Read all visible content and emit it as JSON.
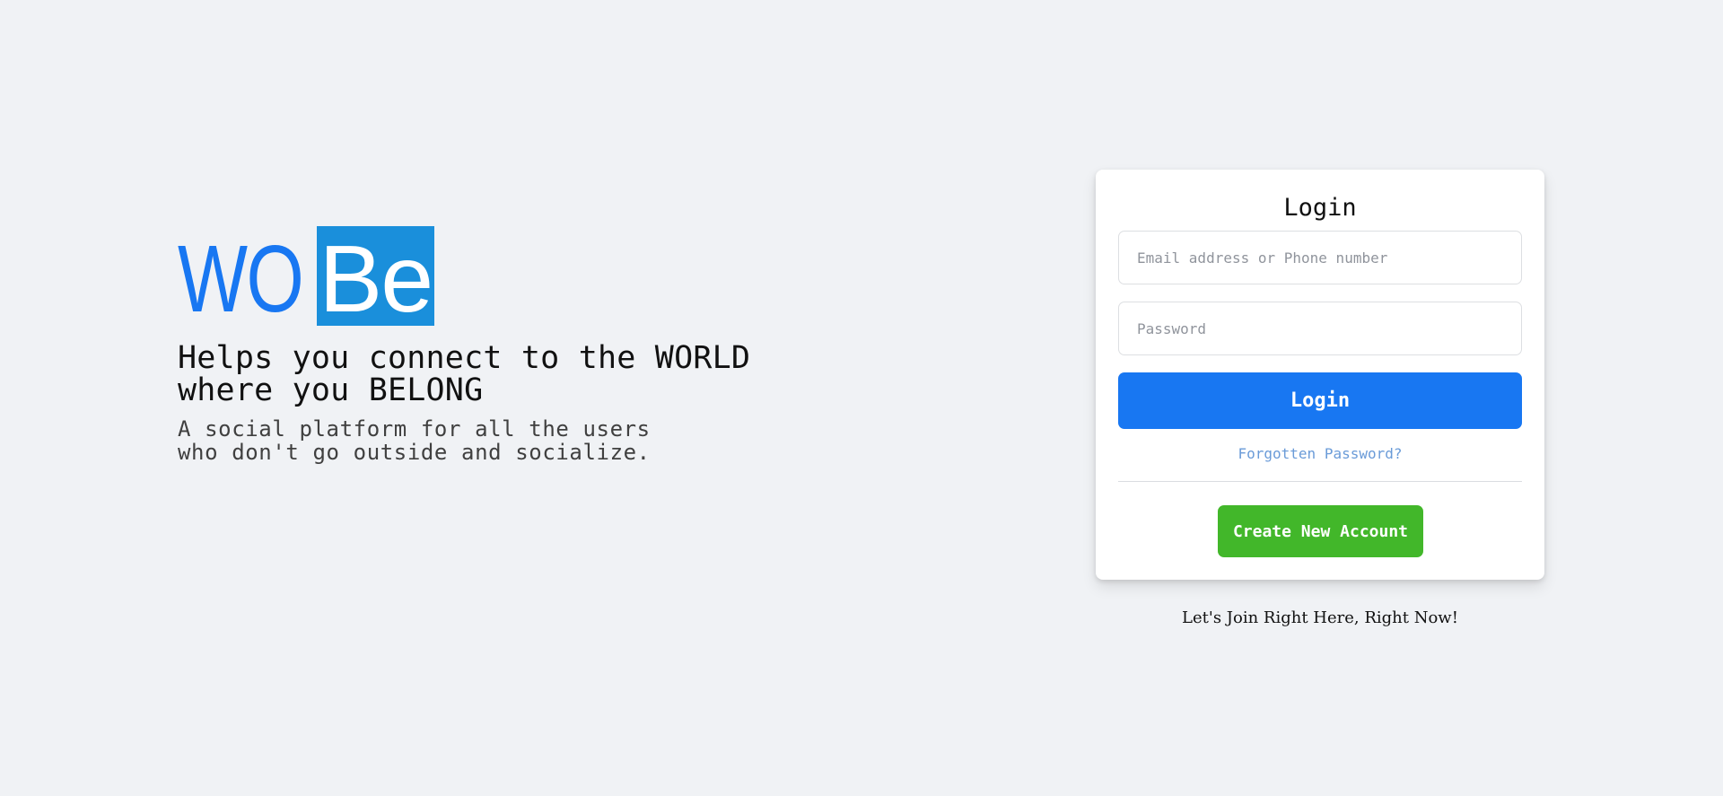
{
  "brand": {
    "logo_part_1": "WO",
    "logo_part_2": "Be",
    "tagline_line_1": "Helps you connect to the WORLD",
    "tagline_line_2": "where you BELONG",
    "subtagline_line_1": "A social platform for all the users",
    "subtagline_line_2": "who don't go outside and socialize."
  },
  "login_form": {
    "title": "Login",
    "email_placeholder": "Email address or Phone number",
    "email_value": "",
    "password_placeholder": "Password",
    "password_value": "",
    "login_button": "Login",
    "forgot_password": "Forgotten Password?",
    "create_account_button": "Create New Account"
  },
  "footer": {
    "join_text": "Let's Join Right Here, Right Now!"
  },
  "colors": {
    "background": "#f0f2f5",
    "primary": "#1877f2",
    "logo_highlight": "#1a8fdb",
    "create_account": "#42b72a",
    "link": "#6a9bd8"
  }
}
